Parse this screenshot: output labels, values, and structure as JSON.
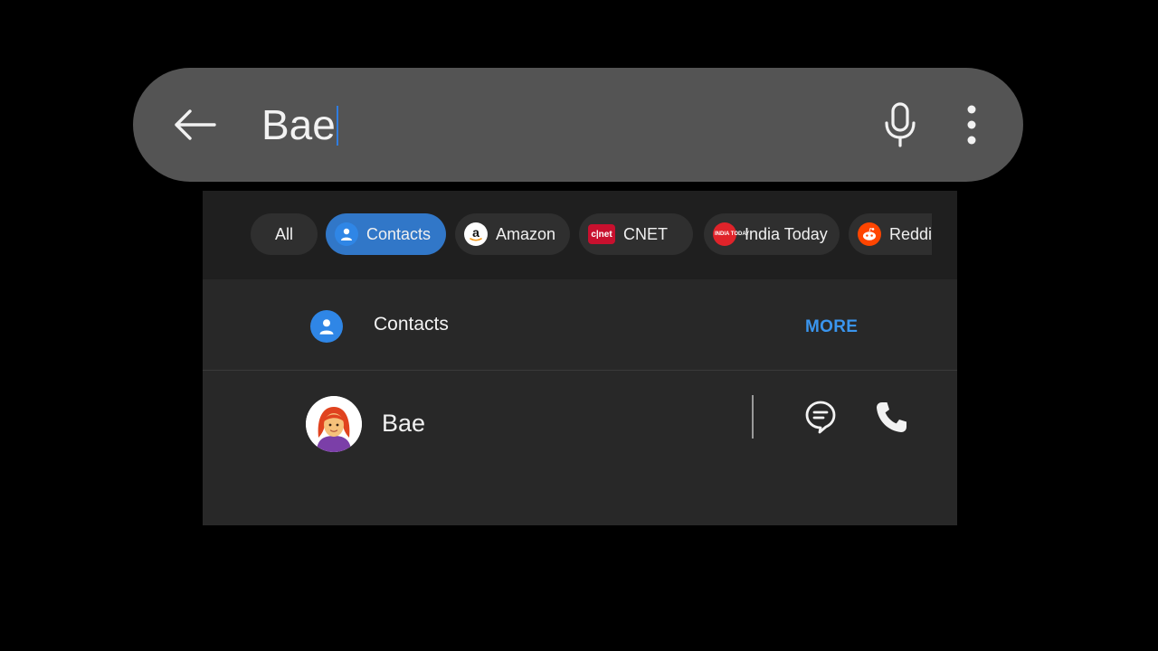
{
  "search": {
    "query": "Bae"
  },
  "filters": [
    {
      "label": "All",
      "active": false
    },
    {
      "label": "Contacts",
      "active": true,
      "icon": "person-icon"
    },
    {
      "label": "Amazon",
      "active": false,
      "icon": "amazon-logo-icon"
    },
    {
      "label": "CNET",
      "active": false,
      "icon": "cnet-logo-icon",
      "logo_text": "c|net"
    },
    {
      "label": "India Today",
      "active": false,
      "icon": "india-today-logo-icon",
      "logo_text": "INDIA TODAY"
    },
    {
      "label": "Reddi",
      "active": false,
      "icon": "reddit-logo-icon"
    }
  ],
  "contacts_section": {
    "title": "Contacts",
    "more_label": "MORE"
  },
  "contacts": [
    {
      "name": "Bae",
      "avatar": "woman-red-hair-emoji"
    }
  ],
  "colors": {
    "accent": "#3177c8",
    "link": "#3a95ee",
    "search_bar": "#545454",
    "panel": "#282828",
    "filter_strip": "#1f1f1f"
  }
}
